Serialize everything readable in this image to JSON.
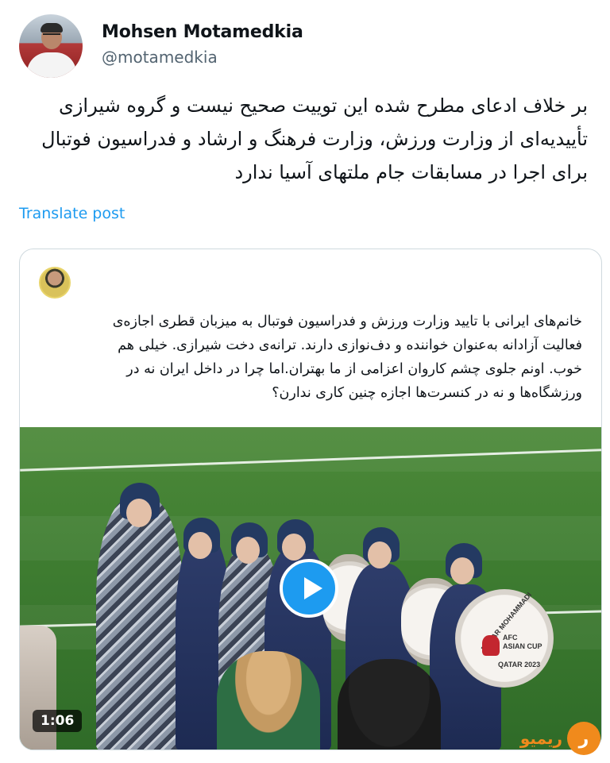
{
  "author": {
    "name": "Mohsen Motamedkia",
    "handle": "@motamedkia"
  },
  "tweet": {
    "lines": [
      "بر خلاف ادعای مطرح شده این توییت صحیح نیست و گروه شیرازی",
      "تأییدیه‌ای از وزارت ورزش، وزارت فرهنگ و ارشاد و فدراسیون فوتبال",
      "برای اجرا در مسابقات جام ملتهای آسیا ندارد"
    ],
    "translate_label": "Translate post"
  },
  "quoted": {
    "lines": [
      "خانم‌های ایرانی با تایید وزارت ورزش و فدراسیون فوتبال به میزبان قطری اجازه‌ی",
      "فعالیت آزادانه به‌عنوان خواننده و دف‌نوازی دارند. ترانه‌ی دخت شیرازی. خیلی هم",
      "خوب. اونم جلوی چشم کاروان اعزامی از ما بهتران.اما چرا در داخل ایران نه در",
      "ورزشگاه‌ها و نه در کنسرت‌ها اجازه چنین کاری ندارن؟"
    ],
    "video": {
      "duration": "1:06",
      "drum_brand": "BAHAR MOHAMMADI",
      "drum_logo_line1": "AFC",
      "drum_logo_line2": "ASIAN CUP",
      "drum_logo_line3": "QATAR 2023"
    }
  },
  "watermark": {
    "text": "ریمیو",
    "logo": "ر"
  },
  "colors": {
    "accent": "#1d9bf0",
    "text": "#0f1419",
    "muted": "#536471",
    "border": "#cfd9de",
    "watermark": "#f08a1c"
  }
}
